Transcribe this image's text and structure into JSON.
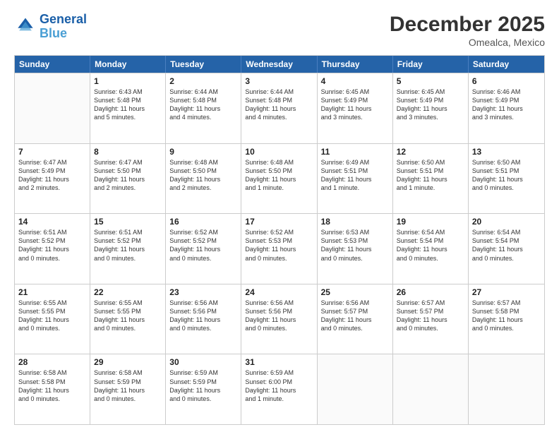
{
  "logo": {
    "line1": "General",
    "line2": "Blue"
  },
  "title": "December 2025",
  "location": "Omealca, Mexico",
  "days_of_week": [
    "Sunday",
    "Monday",
    "Tuesday",
    "Wednesday",
    "Thursday",
    "Friday",
    "Saturday"
  ],
  "weeks": [
    [
      {
        "day": "",
        "info": ""
      },
      {
        "day": "1",
        "info": "Sunrise: 6:43 AM\nSunset: 5:48 PM\nDaylight: 11 hours\nand 5 minutes."
      },
      {
        "day": "2",
        "info": "Sunrise: 6:44 AM\nSunset: 5:48 PM\nDaylight: 11 hours\nand 4 minutes."
      },
      {
        "day": "3",
        "info": "Sunrise: 6:44 AM\nSunset: 5:48 PM\nDaylight: 11 hours\nand 4 minutes."
      },
      {
        "day": "4",
        "info": "Sunrise: 6:45 AM\nSunset: 5:49 PM\nDaylight: 11 hours\nand 3 minutes."
      },
      {
        "day": "5",
        "info": "Sunrise: 6:45 AM\nSunset: 5:49 PM\nDaylight: 11 hours\nand 3 minutes."
      },
      {
        "day": "6",
        "info": "Sunrise: 6:46 AM\nSunset: 5:49 PM\nDaylight: 11 hours\nand 3 minutes."
      }
    ],
    [
      {
        "day": "7",
        "info": "Sunrise: 6:47 AM\nSunset: 5:49 PM\nDaylight: 11 hours\nand 2 minutes."
      },
      {
        "day": "8",
        "info": "Sunrise: 6:47 AM\nSunset: 5:50 PM\nDaylight: 11 hours\nand 2 minutes."
      },
      {
        "day": "9",
        "info": "Sunrise: 6:48 AM\nSunset: 5:50 PM\nDaylight: 11 hours\nand 2 minutes."
      },
      {
        "day": "10",
        "info": "Sunrise: 6:48 AM\nSunset: 5:50 PM\nDaylight: 11 hours\nand 1 minute."
      },
      {
        "day": "11",
        "info": "Sunrise: 6:49 AM\nSunset: 5:51 PM\nDaylight: 11 hours\nand 1 minute."
      },
      {
        "day": "12",
        "info": "Sunrise: 6:50 AM\nSunset: 5:51 PM\nDaylight: 11 hours\nand 1 minute."
      },
      {
        "day": "13",
        "info": "Sunrise: 6:50 AM\nSunset: 5:51 PM\nDaylight: 11 hours\nand 0 minutes."
      }
    ],
    [
      {
        "day": "14",
        "info": "Sunrise: 6:51 AM\nSunset: 5:52 PM\nDaylight: 11 hours\nand 0 minutes."
      },
      {
        "day": "15",
        "info": "Sunrise: 6:51 AM\nSunset: 5:52 PM\nDaylight: 11 hours\nand 0 minutes."
      },
      {
        "day": "16",
        "info": "Sunrise: 6:52 AM\nSunset: 5:52 PM\nDaylight: 11 hours\nand 0 minutes."
      },
      {
        "day": "17",
        "info": "Sunrise: 6:52 AM\nSunset: 5:53 PM\nDaylight: 11 hours\nand 0 minutes."
      },
      {
        "day": "18",
        "info": "Sunrise: 6:53 AM\nSunset: 5:53 PM\nDaylight: 11 hours\nand 0 minutes."
      },
      {
        "day": "19",
        "info": "Sunrise: 6:54 AM\nSunset: 5:54 PM\nDaylight: 11 hours\nand 0 minutes."
      },
      {
        "day": "20",
        "info": "Sunrise: 6:54 AM\nSunset: 5:54 PM\nDaylight: 11 hours\nand 0 minutes."
      }
    ],
    [
      {
        "day": "21",
        "info": "Sunrise: 6:55 AM\nSunset: 5:55 PM\nDaylight: 11 hours\nand 0 minutes."
      },
      {
        "day": "22",
        "info": "Sunrise: 6:55 AM\nSunset: 5:55 PM\nDaylight: 11 hours\nand 0 minutes."
      },
      {
        "day": "23",
        "info": "Sunrise: 6:56 AM\nSunset: 5:56 PM\nDaylight: 11 hours\nand 0 minutes."
      },
      {
        "day": "24",
        "info": "Sunrise: 6:56 AM\nSunset: 5:56 PM\nDaylight: 11 hours\nand 0 minutes."
      },
      {
        "day": "25",
        "info": "Sunrise: 6:56 AM\nSunset: 5:57 PM\nDaylight: 11 hours\nand 0 minutes."
      },
      {
        "day": "26",
        "info": "Sunrise: 6:57 AM\nSunset: 5:57 PM\nDaylight: 11 hours\nand 0 minutes."
      },
      {
        "day": "27",
        "info": "Sunrise: 6:57 AM\nSunset: 5:58 PM\nDaylight: 11 hours\nand 0 minutes."
      }
    ],
    [
      {
        "day": "28",
        "info": "Sunrise: 6:58 AM\nSunset: 5:58 PM\nDaylight: 11 hours\nand 0 minutes."
      },
      {
        "day": "29",
        "info": "Sunrise: 6:58 AM\nSunset: 5:59 PM\nDaylight: 11 hours\nand 0 minutes."
      },
      {
        "day": "30",
        "info": "Sunrise: 6:59 AM\nSunset: 5:59 PM\nDaylight: 11 hours\nand 0 minutes."
      },
      {
        "day": "31",
        "info": "Sunrise: 6:59 AM\nSunset: 6:00 PM\nDaylight: 11 hours\nand 1 minute."
      },
      {
        "day": "",
        "info": ""
      },
      {
        "day": "",
        "info": ""
      },
      {
        "day": "",
        "info": ""
      }
    ]
  ]
}
